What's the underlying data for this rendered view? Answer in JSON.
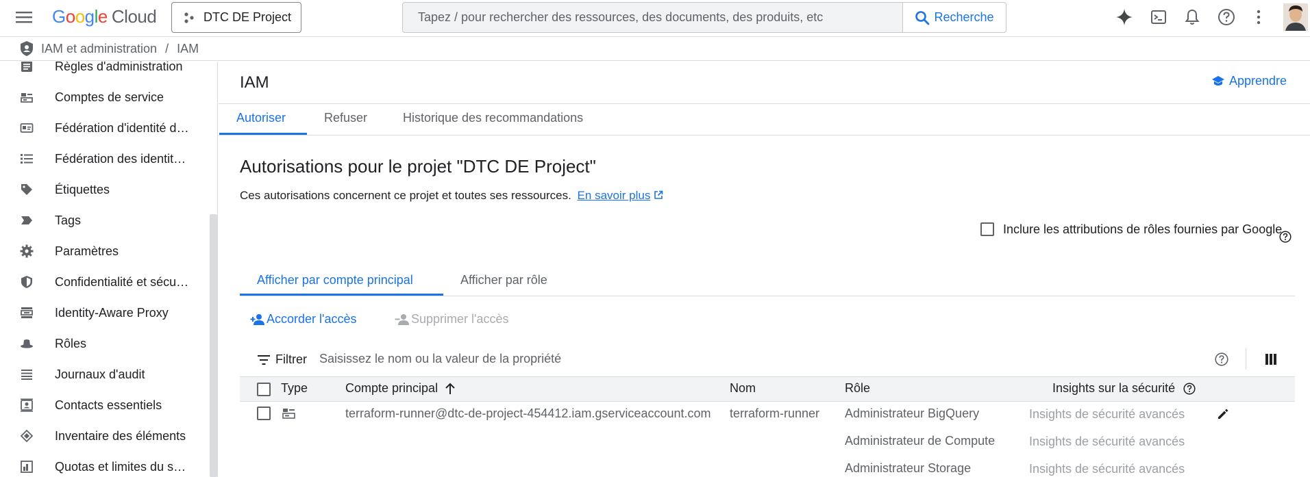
{
  "topbar": {
    "brand_google": "Google",
    "brand_cloud": "Cloud",
    "project_name": "DTC DE Project",
    "search_placeholder": "Tapez / pour rechercher des ressources, des documents, des produits, etc",
    "search_button": "Recherche"
  },
  "breadcrumb": {
    "section": "IAM et administration",
    "separator": "/",
    "page": "IAM"
  },
  "sidebar": {
    "items": [
      {
        "label": "Règles d'administration",
        "icon": "document-list-icon"
      },
      {
        "label": "Comptes de service",
        "icon": "service-account-icon"
      },
      {
        "label": "Fédération d'identité de…",
        "icon": "id-card-icon"
      },
      {
        "label": "Fédération des identité…",
        "icon": "list-icon"
      },
      {
        "label": "Étiquettes",
        "icon": "tag-icon"
      },
      {
        "label": "Tags",
        "icon": "label-chevron-icon"
      },
      {
        "label": "Paramètres",
        "icon": "gear-icon"
      },
      {
        "label": "Confidentialité et sécur…",
        "icon": "shield-icon"
      },
      {
        "label": "Identity-Aware Proxy",
        "icon": "proxy-icon"
      },
      {
        "label": "Rôles",
        "icon": "hat-icon"
      },
      {
        "label": "Journaux d'audit",
        "icon": "lines-icon"
      },
      {
        "label": "Contacts essentiels",
        "icon": "contact-icon"
      },
      {
        "label": "Inventaire des éléments",
        "icon": "diamond-icon"
      },
      {
        "label": "Quotas et limites du sy…",
        "icon": "quota-icon"
      }
    ]
  },
  "main": {
    "page_title": "IAM",
    "learn_label": "Apprendre",
    "tabs": [
      "Autoriser",
      "Refuser",
      "Historique des recommandations"
    ],
    "active_tab": "Autoriser",
    "heading": "Autorisations pour le projet \"DTC DE Project\"",
    "description": "Ces autorisations concernent ce projet et toutes ses ressources.",
    "learn_more_link": "En savoir plus",
    "include_google_roles_label": "Inclure les attributions de rôles fournies par Google",
    "view_tabs": [
      "Afficher par compte principal",
      "Afficher par rôle"
    ],
    "grant_access": "Accorder l'accès",
    "remove_access": "Supprimer l'accès",
    "filter_label": "Filtrer",
    "filter_placeholder": "Saisissez le nom ou la valeur de la propriété",
    "table": {
      "headers": [
        "Type",
        "Compte principal",
        "Nom",
        "Rôle",
        "Insights sur la sécurité"
      ],
      "rows": [
        {
          "principal": "terraform-runner@dtc-de-project-454412.iam.gserviceaccount.com",
          "name": "terraform-runner",
          "roles": [
            "Administrateur BigQuery",
            "Administrateur de Compute",
            "Administrateur Storage"
          ],
          "insights": [
            "Insights de sécurité avancés",
            "Insights de sécurité avancés",
            "Insights de sécurité avancés"
          ]
        }
      ]
    }
  },
  "colors": {
    "accent": "#1a73e8",
    "text": "#202124",
    "secondary": "#5f6368",
    "muted": "#9aa0a6",
    "border": "#dadce0"
  }
}
